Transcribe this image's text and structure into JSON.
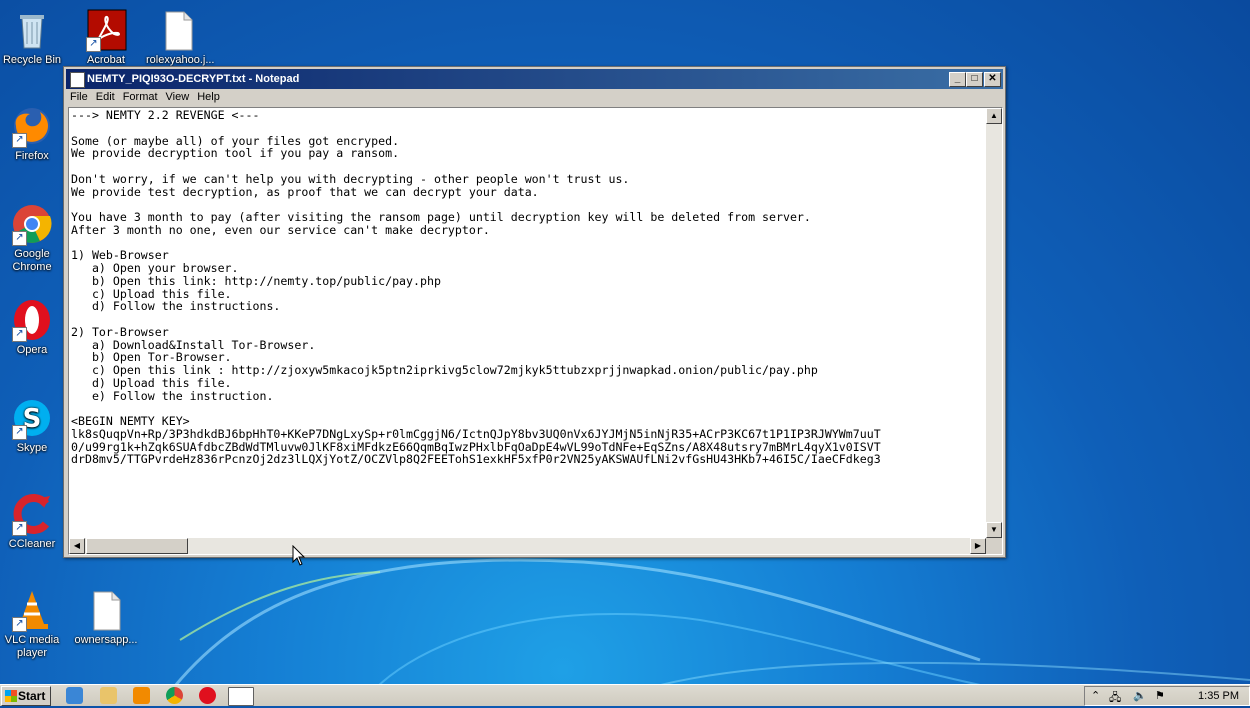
{
  "desktop": {
    "icons": [
      {
        "label": "Recycle Bin"
      },
      {
        "label": "Acrobat"
      },
      {
        "label": "rolexyahoo.j..."
      },
      {
        "label": "Firefox"
      },
      {
        "label": "Google Chrome"
      },
      {
        "label": "Opera"
      },
      {
        "label": "Skype"
      },
      {
        "label": "CCleaner"
      },
      {
        "label": "VLC media player"
      },
      {
        "label": "ownersapp..."
      }
    ]
  },
  "notepad": {
    "title": "NEMTY_PIQI93O-DECRYPT.txt - Notepad",
    "menu": [
      "File",
      "Edit",
      "Format",
      "View",
      "Help"
    ],
    "content": "---> NEMTY 2.2 REVENGE <---\n\nSome (or maybe all) of your files got encryped.\nWe provide decryption tool if you pay a ransom.\n\nDon't worry, if we can't help you with decrypting - other people won't trust us.\nWe provide test decryption, as proof that we can decrypt your data.\n\nYou have 3 month to pay (after visiting the ransom page) until decryption key will be deleted from server.\nAfter 3 month no one, even our service can't make decryptor.\n\n1) Web-Browser\n   a) Open your browser.\n   b) Open this link: http://nemty.top/public/pay.php\n   c) Upload this file.\n   d) Follow the instructions.\n\n2) Tor-Browser\n   a) Download&Install Tor-Browser.\n   b) Open Tor-Browser.\n   c) Open this link : http://zjoxyw5mkacojk5ptn2iprkivg5clow72mjkyk5ttubzxprjjnwapkad.onion/public/pay.php\n   d) Upload this file.\n   e) Follow the instruction.\n\n<BEGIN NEMTY KEY>\nlk8sQuqpVn+Rp/3P3hdkdBJ6bpHhT0+KKeP7DNgLxySp+r0lmCggjN6/IctnQJpY8bv3UQ0nVx6JYJMjN5inNjR35+ACrP3KC67t1P1IP3RJWYWm7uuT\n0/u99rg1k+hZqk6SUAfdbcZBdWdTMluvw0JlKF8xiMFdkzE66QqmBqIwzPHxlbFqOaDpE4wVL99oTdNFe+EqSZns/A8X48utsry7mBMrL4qyX1v0ISVT\ndrD8mv5/TTGPvrdeHz836rPcnzOj2dz3lLQXjYotZ/OCZVlp8Q2FEETohS1exkHF5xfP0r2VN25yAKSWAUfLNi2vfGsHU43HKb7+46I5C/IaeCFdkeg3"
  },
  "taskbar": {
    "start_label": "Start",
    "clock": "1:35 PM"
  }
}
